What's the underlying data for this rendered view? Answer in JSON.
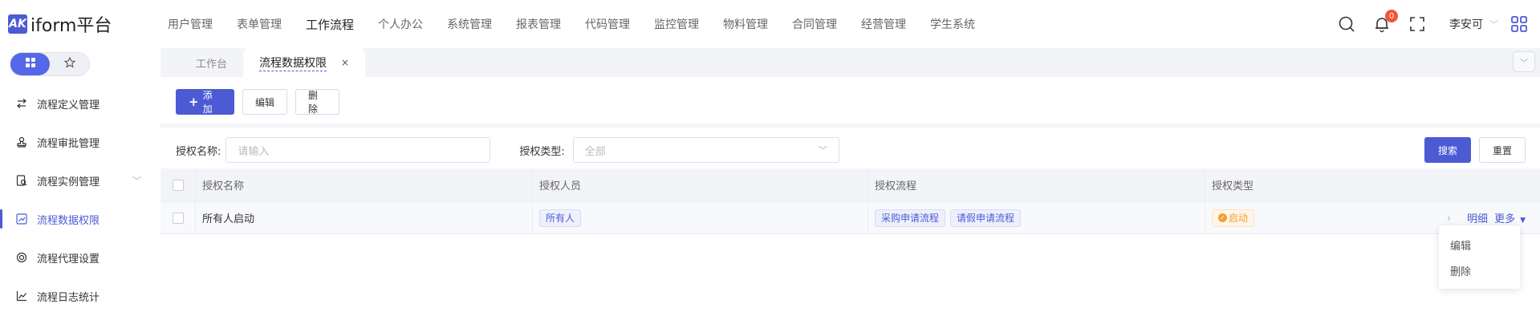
{
  "app": {
    "logo_mark": "AK",
    "logo_text": "iform平台"
  },
  "topnav": {
    "items": [
      "用户管理",
      "表单管理",
      "工作流程",
      "个人办公",
      "系统管理",
      "报表管理",
      "代码管理",
      "监控管理",
      "物料管理",
      "合同管理",
      "经营管理",
      "学生系统"
    ],
    "active": "工作流程"
  },
  "header": {
    "notification_count": "0",
    "username": "李安可"
  },
  "sidebar": {
    "items": [
      {
        "label": "流程定义管理",
        "icon": "arrows-swap-icon"
      },
      {
        "label": "流程审批管理",
        "icon": "stamp-icon"
      },
      {
        "label": "流程实例管理",
        "icon": "document-search-icon"
      },
      {
        "label": "流程数据权限",
        "icon": "edit-chart-icon"
      },
      {
        "label": "流程代理设置",
        "icon": "agent-icon"
      },
      {
        "label": "流程日志统计",
        "icon": "line-chart-icon"
      }
    ],
    "active": "流程数据权限"
  },
  "tabs": {
    "home": "工作台",
    "current": "流程数据权限",
    "close": "×"
  },
  "toolbar": {
    "add": "添加",
    "edit": "编辑",
    "delete": "删除"
  },
  "filter": {
    "name_label": "授权名称:",
    "name_placeholder": "请输入",
    "type_label": "授权类型:",
    "type_value": "全部",
    "search": "搜索",
    "reset": "重置"
  },
  "table": {
    "columns": [
      "授权名称",
      "授权人员",
      "授权流程",
      "授权类型"
    ],
    "rows": [
      {
        "name": "所有人启动",
        "persons": [
          "所有人"
        ],
        "processes": [
          "采购申请流程",
          "请假申请流程"
        ],
        "type": "启动"
      }
    ],
    "actions": {
      "detail": "明细",
      "more": "更多"
    }
  },
  "more_menu": {
    "items": [
      "编辑",
      "删除"
    ]
  },
  "colors": {
    "accent": "#4c5bd4",
    "badge": "#f5543a",
    "warning": "#f0a030"
  }
}
